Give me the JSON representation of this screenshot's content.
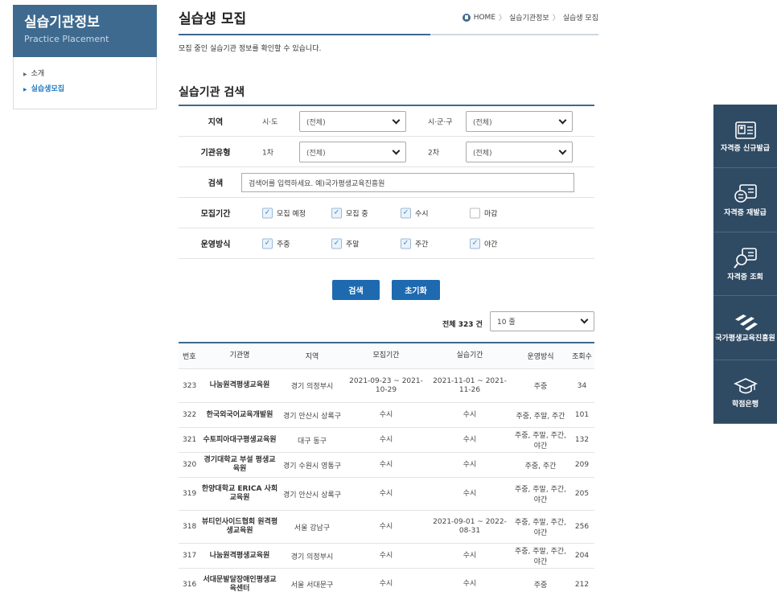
{
  "lnb": {
    "title": "실습기관정보",
    "subtitle": "Practice Placement",
    "items": [
      {
        "label": "소개",
        "active": false
      },
      {
        "label": "실습생모집",
        "active": true
      }
    ]
  },
  "page": {
    "title": "실습생 모집",
    "description": "모집 중인 실습기관 정보를 확인할 수 있습니다.",
    "breadcrumb": [
      "HOME",
      "실습기관정보",
      "실습생 모집"
    ]
  },
  "search": {
    "section_title": "실습기관 검색",
    "region": {
      "label": "지역",
      "sido_label": "시·도",
      "sido_value": "(전체)",
      "sigungu_label": "시·군·구",
      "sigungu_value": "(전체)"
    },
    "type": {
      "label": "기관유형",
      "first_label": "1차",
      "first_value": "(전체)",
      "second_label": "2차",
      "second_value": "(전체)"
    },
    "keyword": {
      "label": "검색",
      "value": "검색어를 입력하세요. 예)국가평생교육진흥원"
    },
    "period": {
      "label": "모집기간",
      "options": [
        {
          "label": "모집 예정",
          "checked": true
        },
        {
          "label": "모집 중",
          "checked": true
        },
        {
          "label": "수시",
          "checked": true
        },
        {
          "label": "마감",
          "checked": false
        }
      ]
    },
    "operation": {
      "label": "운영방식",
      "options": [
        {
          "label": "주중",
          "checked": true
        },
        {
          "label": "주말",
          "checked": true
        },
        {
          "label": "주간",
          "checked": true
        },
        {
          "label": "야간",
          "checked": true
        }
      ]
    },
    "search_button": "검색",
    "reset_button": "초기화"
  },
  "list": {
    "total_label": "전체 323 건",
    "rows_per_page": "10 줄",
    "columns": [
      "번호",
      "기관명",
      "지역",
      "모집기간",
      "실습기간",
      "운영방식",
      "조회수"
    ],
    "rows": [
      {
        "no": "323",
        "name": "나눔원격평생교육원",
        "region": "경기 의정부시",
        "recruit": "2021-09-23 ~ 2021-10-29",
        "practice": "2021-11-01 ~ 2021-11-26",
        "mode": "주중",
        "views": "34"
      },
      {
        "no": "322",
        "name": "한국외국어교육개발원",
        "region": "경기 안산시 상록구",
        "recruit": "수시",
        "practice": "수시",
        "mode": "주중, 주말, 주간",
        "views": "101"
      },
      {
        "no": "321",
        "name": "수토피아대구평생교육원",
        "region": "대구 동구",
        "recruit": "수시",
        "practice": "수시",
        "mode": "주중, 주말, 주간, 야간",
        "views": "132"
      },
      {
        "no": "320",
        "name": "경기대학교 부설 평생교육원",
        "region": "경기 수원시 영통구",
        "recruit": "수시",
        "practice": "수시",
        "mode": "주중, 주간",
        "views": "209"
      },
      {
        "no": "319",
        "name": "한양대학교 ERICA 사회교육원",
        "region": "경기 안산시 상록구",
        "recruit": "수시",
        "practice": "수시",
        "mode": "주중, 주말, 주간, 야간",
        "views": "205"
      },
      {
        "no": "318",
        "name": "뷰티인사이드협회 원격평생교육원",
        "region": "서울 강남구",
        "recruit": "수시",
        "practice": "2021-09-01 ~ 2022-08-31",
        "mode": "주중, 주말, 주간, 야간",
        "views": "256"
      },
      {
        "no": "317",
        "name": "나눔원격평생교육원",
        "region": "경기 의정부시",
        "recruit": "수시",
        "practice": "수시",
        "mode": "주중, 주말, 주간, 야간",
        "views": "204"
      },
      {
        "no": "316",
        "name": "서대문발달장애인평생교육센터",
        "region": "서울 서대문구",
        "recruit": "수시",
        "practice": "수시",
        "mode": "주중",
        "views": "212"
      }
    ]
  },
  "quick": [
    {
      "label": "자격증 신규발급",
      "icon": "certificate-card-icon"
    },
    {
      "label": "자격증 재발급",
      "icon": "certificate-reissue-icon"
    },
    {
      "label": "자격증 조회",
      "icon": "certificate-search-icon"
    },
    {
      "label": "국가평생교육진흥원",
      "icon": "nile-logo-icon"
    },
    {
      "label": "학점은행",
      "icon": "graduation-cap-icon"
    }
  ]
}
